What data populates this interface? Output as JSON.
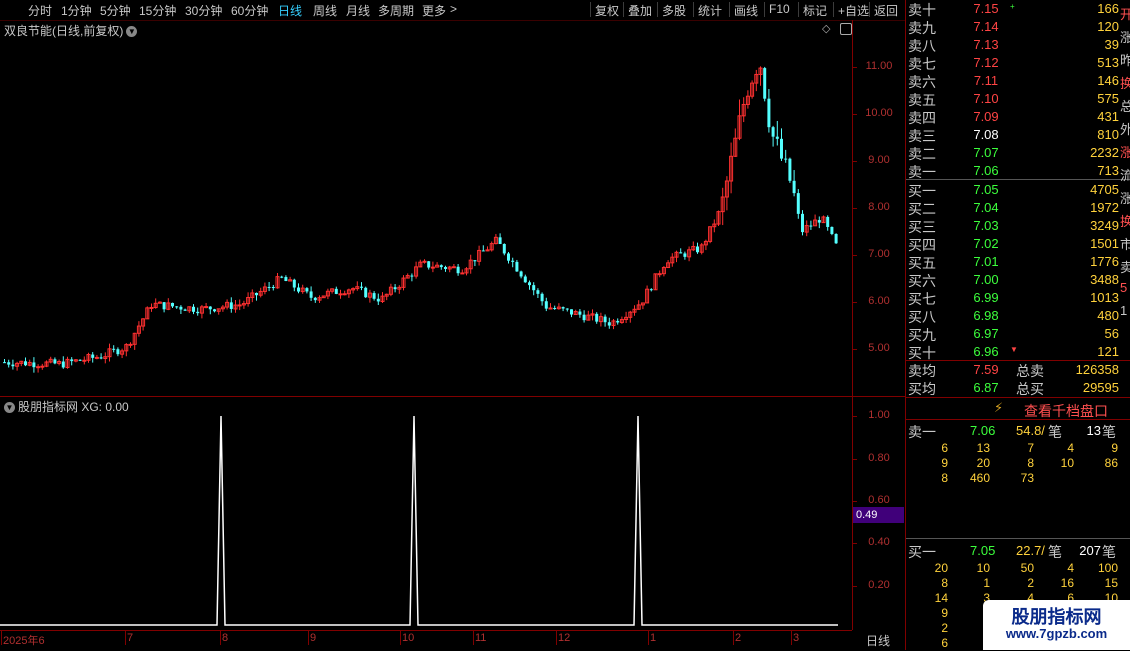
{
  "toolbar": {
    "left": [
      {
        "label": "分时"
      },
      {
        "label": "1分钟"
      },
      {
        "label": "5分钟"
      },
      {
        "label": "15分钟"
      },
      {
        "label": "30分钟"
      },
      {
        "label": "60分钟"
      },
      {
        "label": "日线",
        "active": true
      },
      {
        "label": "周线"
      },
      {
        "label": "月线"
      },
      {
        "label": "多周期"
      },
      {
        "label": "更多"
      }
    ],
    "more_arrow": ">",
    "right": [
      {
        "label": "复权"
      },
      {
        "label": "叠加"
      },
      {
        "label": "多股"
      },
      {
        "label": "统计"
      },
      {
        "label": "画线"
      },
      {
        "label": "F10"
      },
      {
        "label": "标记"
      },
      {
        "label": "+自选"
      },
      {
        "label": "返回"
      }
    ]
  },
  "main_chart": {
    "title": "双良节能(日线,前复权)",
    "price_ticks": [
      "11.00",
      "10.00",
      "9.00",
      "8.00",
      "7.00",
      "6.00",
      "5.00"
    ],
    "candles_ohlc_count_note": "",
    "up_color": "#ff3030",
    "down_color": "#54ffff"
  },
  "indicator": {
    "title": "股朋指标网 XG: 0.00",
    "ticks": [
      "1.00",
      "0.80",
      "0.60",
      "0.40",
      "0.20"
    ],
    "marker_value": "0.49",
    "line_color": "#ffffff"
  },
  "date_axis": {
    "labels": [
      "2025年6",
      "7",
      "8",
      "9",
      "10",
      "11",
      "12",
      "1",
      "2",
      "3"
    ],
    "period": "日线"
  },
  "quote": {
    "sells": [
      {
        "label": "卖十",
        "price": "7.15",
        "vol": "166",
        "mark": "+"
      },
      {
        "label": "卖九",
        "price": "7.14",
        "vol": "120"
      },
      {
        "label": "卖八",
        "price": "7.13",
        "vol": "39"
      },
      {
        "label": "卖七",
        "price": "7.12",
        "vol": "513"
      },
      {
        "label": "卖六",
        "price": "7.11",
        "vol": "146"
      },
      {
        "label": "卖五",
        "price": "7.10",
        "vol": "575"
      },
      {
        "label": "卖四",
        "price": "7.09",
        "vol": "431"
      },
      {
        "label": "卖三",
        "price": "7.08",
        "vol": "810"
      },
      {
        "label": "卖二",
        "price": "7.07",
        "vol": "2232"
      },
      {
        "label": "卖一",
        "price": "7.06",
        "vol": "713"
      }
    ],
    "buys": [
      {
        "label": "买一",
        "price": "7.05",
        "vol": "4705"
      },
      {
        "label": "买二",
        "price": "7.04",
        "vol": "1972"
      },
      {
        "label": "买三",
        "price": "7.03",
        "vol": "3249"
      },
      {
        "label": "买四",
        "price": "7.02",
        "vol": "1501"
      },
      {
        "label": "买五",
        "price": "7.01",
        "vol": "1776"
      },
      {
        "label": "买六",
        "price": "7.00",
        "vol": "3488"
      },
      {
        "label": "买七",
        "price": "6.99",
        "vol": "1013"
      },
      {
        "label": "买八",
        "price": "6.98",
        "vol": "480"
      },
      {
        "label": "买九",
        "price": "6.97",
        "vol": "56"
      },
      {
        "label": "买十",
        "price": "6.96",
        "vol": "121",
        "mark": "▼"
      }
    ],
    "sell_avg_label": "卖均",
    "sell_avg": "7.59",
    "total_sell_label": "总卖",
    "total_sell": "126358",
    "buy_avg_label": "买均",
    "buy_avg": "6.87",
    "total_buy_label": "总买",
    "total_buy": "29595",
    "qk_button": "查看千档盘口",
    "ask1_label": "卖一",
    "ask1_price": "7.06",
    "ask1_lot": "54.8/",
    "ask1_unit": "笔",
    "ask1_count": "13",
    "ask1_unit2": "笔",
    "ask_orders": [
      [
        "6",
        "13",
        "7",
        "4",
        "9"
      ],
      [
        "9",
        "20",
        "8",
        "10",
        "86"
      ],
      [
        "8",
        "460",
        "73",
        "",
        ""
      ]
    ],
    "bid1_label": "买一",
    "bid1_price": "7.05",
    "bid1_lot": "22.7/",
    "bid1_unit": "笔",
    "bid1_count": "207",
    "bid1_unit2": "笔",
    "bid_orders": [
      [
        "20",
        "10",
        "50",
        "4",
        "100"
      ],
      [
        "8",
        "1",
        "2",
        "16",
        "15"
      ],
      [
        "14",
        "3",
        "4",
        "6",
        "10"
      ],
      [
        "9",
        "3",
        "",
        "",
        ""
      ],
      [
        "2",
        "",
        "",
        "",
        ""
      ],
      [
        "6",
        "",
        "",
        "",
        ""
      ]
    ],
    "edge_chars": [
      "开",
      "涨",
      "昨",
      "换",
      "总",
      "外",
      "涨",
      "流",
      "涨",
      "换",
      "市",
      "卖",
      "5",
      "1"
    ]
  },
  "watermark": {
    "title": "股朋指标网",
    "url": "www.7gpzb.com"
  }
}
